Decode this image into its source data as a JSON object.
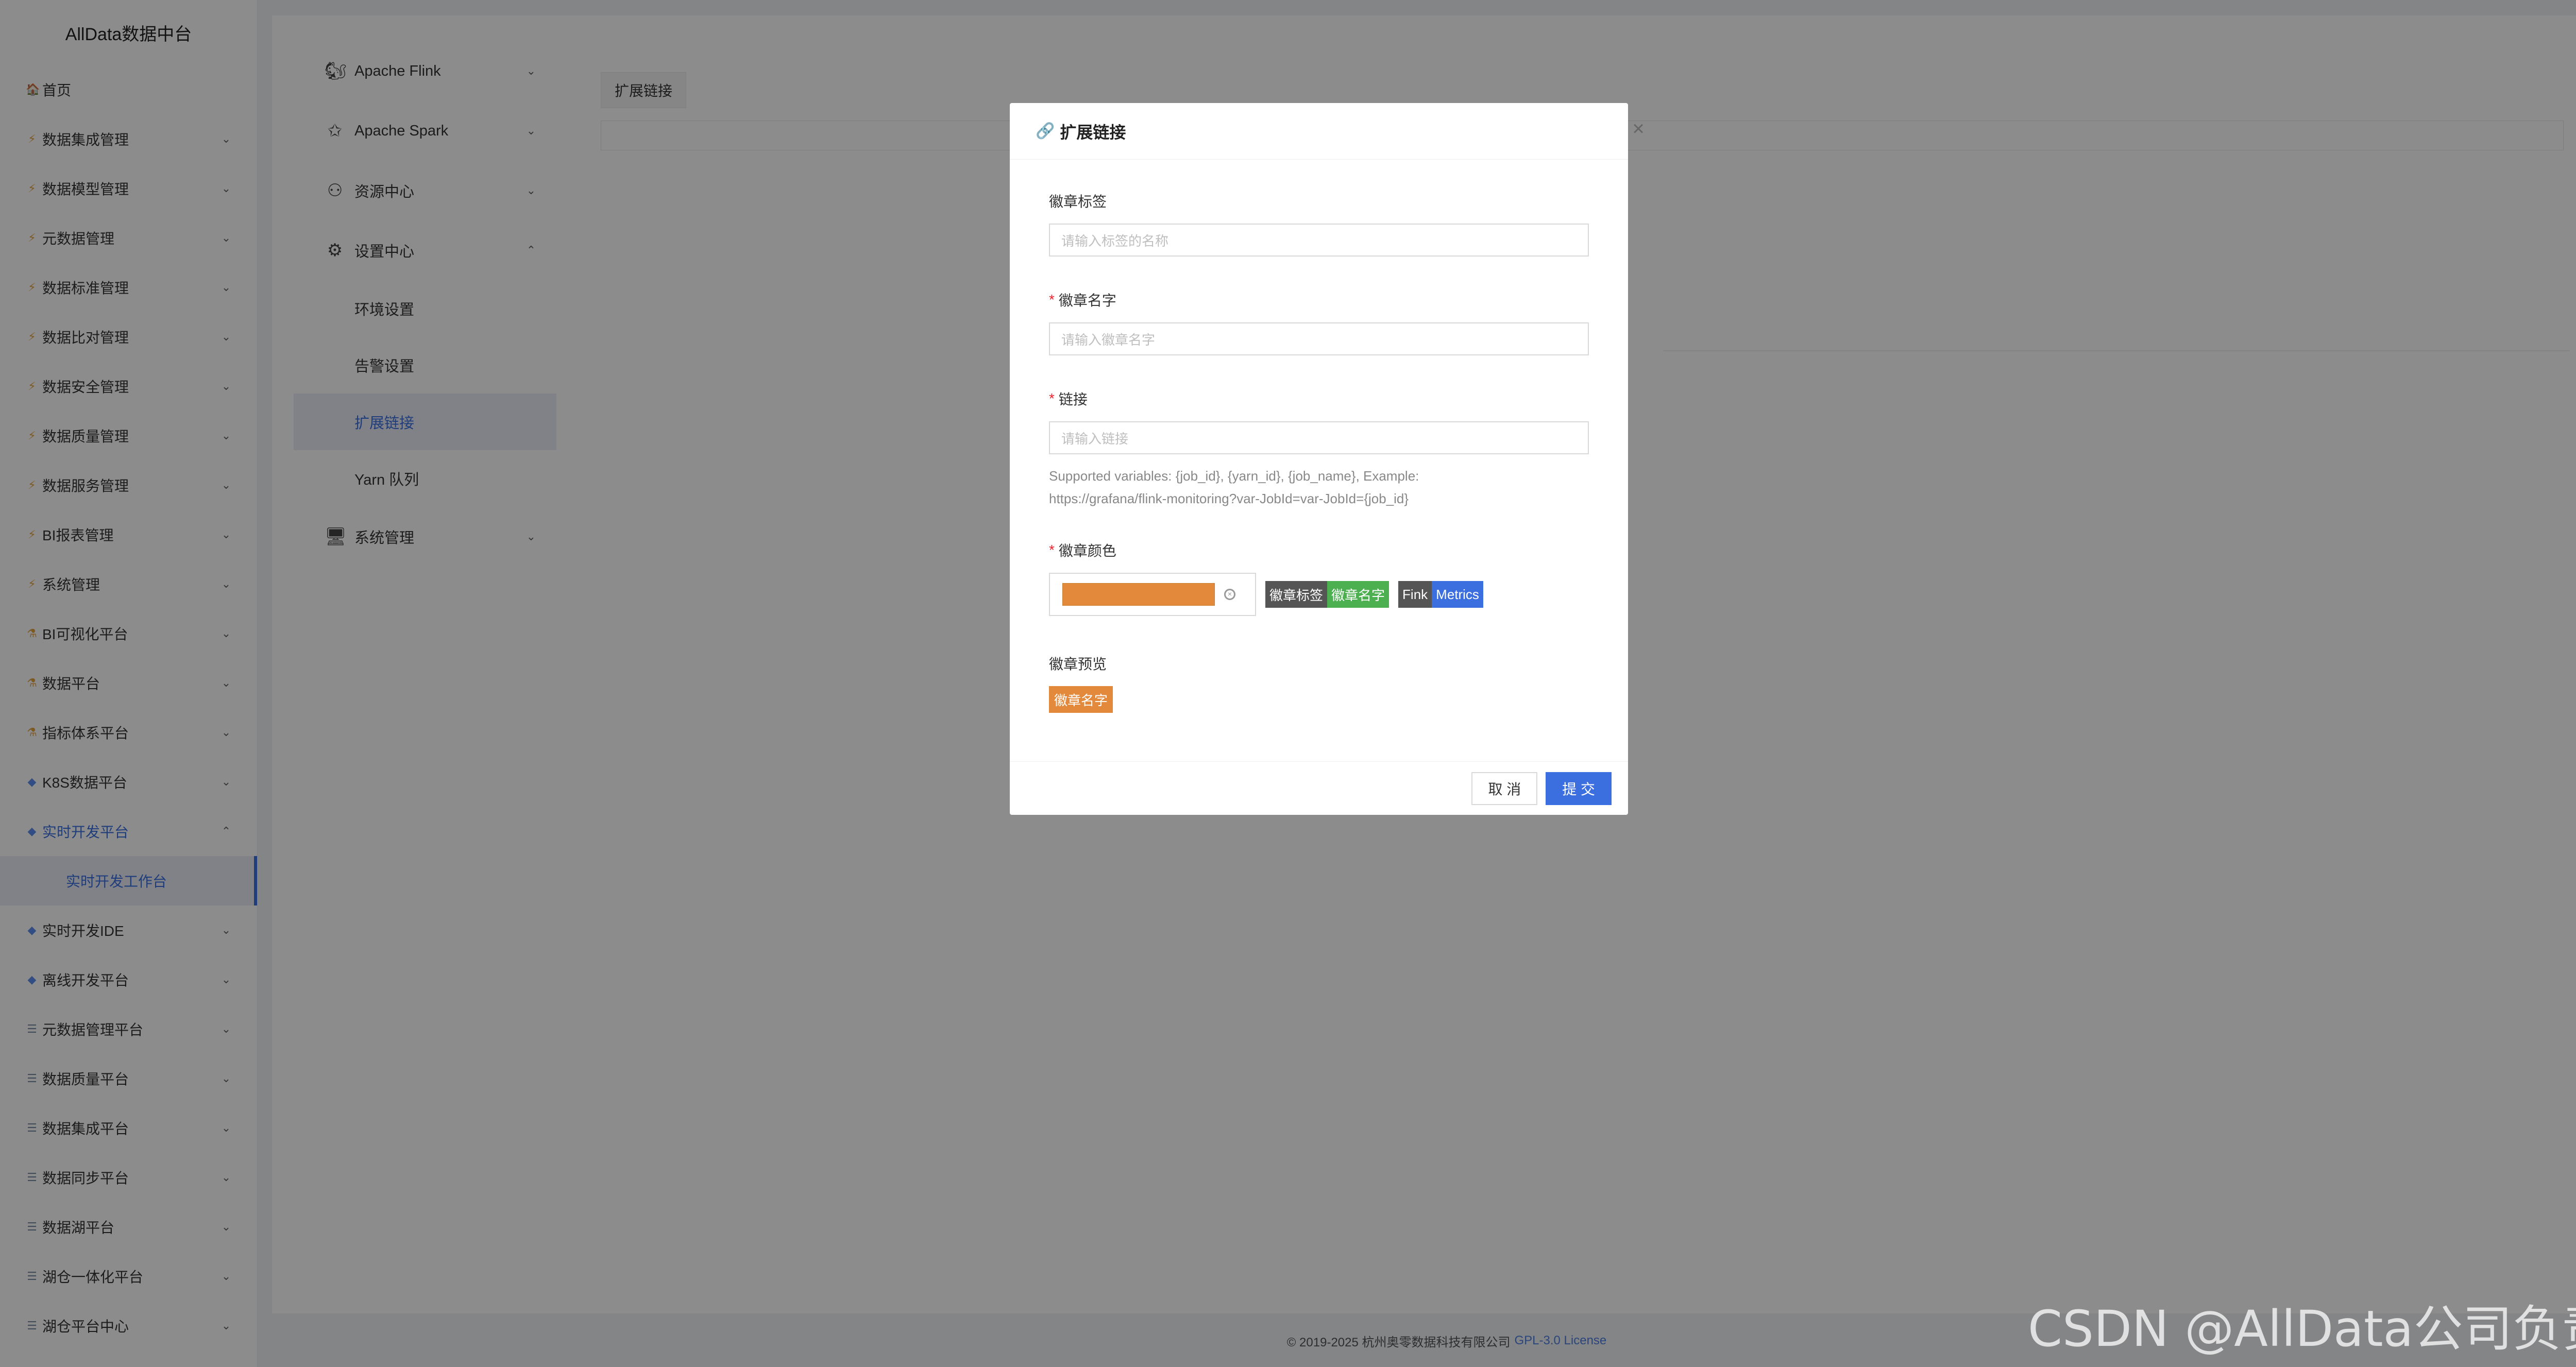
{
  "sidebar": {
    "title": "AllData数据中台",
    "items": [
      {
        "icon": "🏠",
        "label": "首页",
        "arrow": ""
      },
      {
        "icon": "⚡",
        "label": "数据集成管理",
        "arrow": "⌄"
      },
      {
        "icon": "⚡",
        "label": "数据模型管理",
        "arrow": "⌄"
      },
      {
        "icon": "⚡",
        "label": "元数据管理",
        "arrow": "⌄"
      },
      {
        "icon": "⚡",
        "label": "数据标准管理",
        "arrow": "⌄"
      },
      {
        "icon": "⚡",
        "label": "数据比对管理",
        "arrow": "⌄"
      },
      {
        "icon": "⚡",
        "label": "数据安全管理",
        "arrow": "⌄"
      },
      {
        "icon": "⚡",
        "label": "数据质量管理",
        "arrow": "⌄"
      },
      {
        "icon": "⚡",
        "label": "数据服务管理",
        "arrow": "⌄"
      },
      {
        "icon": "⚡",
        "label": "BI报表管理",
        "arrow": "⌄"
      },
      {
        "icon": "⚡",
        "label": "系统管理",
        "arrow": "⌄"
      },
      {
        "icon": "⚗",
        "label": "BI可视化平台",
        "arrow": "⌄"
      },
      {
        "icon": "⚗",
        "label": "数据平台",
        "arrow": "⌄"
      },
      {
        "icon": "⚗",
        "label": "指标体系平台",
        "arrow": "⌄"
      },
      {
        "icon": "◆",
        "label": "K8S数据平台",
        "arrow": "⌄"
      },
      {
        "icon": "◆",
        "label": "实时开发平台",
        "arrow": "⌃"
      },
      {
        "icon": "",
        "label": "实时开发工作台",
        "arrow": ""
      },
      {
        "icon": "◆",
        "label": "实时开发IDE",
        "arrow": "⌄"
      },
      {
        "icon": "◆",
        "label": "离线开发平台",
        "arrow": "⌄"
      },
      {
        "icon": "☰",
        "label": "元数据管理平台",
        "arrow": "⌄"
      },
      {
        "icon": "☰",
        "label": "数据质量平台",
        "arrow": "⌄"
      },
      {
        "icon": "☰",
        "label": "数据集成平台",
        "arrow": "⌄"
      },
      {
        "icon": "☰",
        "label": "数据同步平台",
        "arrow": "⌄"
      },
      {
        "icon": "☰",
        "label": "数据湖平台",
        "arrow": "⌄"
      },
      {
        "icon": "☰",
        "label": "湖仓一体化平台",
        "arrow": "⌄"
      },
      {
        "icon": "☰",
        "label": "湖仓平台中心",
        "arrow": "⌄"
      }
    ]
  },
  "settings": {
    "items": [
      {
        "icon": "🐿",
        "label": "Apache Flink",
        "arrow": "⌄"
      },
      {
        "icon": "✩",
        "label": "Apache Spark",
        "arrow": "⌄"
      },
      {
        "icon": "⚇",
        "label": "资源中心",
        "arrow": "⌄"
      },
      {
        "icon": "⚙",
        "label": "设置中心",
        "arrow": "⌃"
      }
    ],
    "sub_items": [
      "环境设置",
      "告警设置",
      "扩展链接",
      "Yarn 队列"
    ],
    "last_item": {
      "icon": "🖥",
      "label": "系统管理",
      "arrow": "⌄"
    }
  },
  "tab": {
    "label": "扩展链接"
  },
  "footer": {
    "copyright": "© 2019-2025 杭州奥零数据科技有限公司",
    "license": "GPL-3.0 License"
  },
  "modal": {
    "title": "扩展链接",
    "close": "×",
    "fields": {
      "badge_label": {
        "label": "徽章标签",
        "placeholder": "请输入标签的名称"
      },
      "badge_name": {
        "label": "徽章名字",
        "placeholder": "请输入徽章名字"
      },
      "link": {
        "label": "链接",
        "placeholder": "请输入链接",
        "help_1": "Supported variables: {job_id}, {yarn_id}, {job_name}, Example:",
        "help_2": "https://grafana/flink-monitoring?var-JobId=var-JobId={job_id}"
      },
      "color": {
        "label": "徽章颜色",
        "value": "#e3893c"
      },
      "preview": {
        "label": "徽章预览",
        "text": "徽章名字"
      }
    },
    "sample_badges": {
      "badge1_left": "徽章标签",
      "badge1_right": "徽章名字",
      "badge2_left": "Fink",
      "badge2_right": "Metrics"
    },
    "buttons": {
      "cancel": "取 消",
      "submit": "提 交"
    }
  },
  "watermark": "CSDN @AllData公司负责人",
  "colors": {
    "primary": "#3b6fe0",
    "badge_orange": "#e3893c",
    "badge_green": "#4caf50",
    "badge_dark": "#555555"
  }
}
